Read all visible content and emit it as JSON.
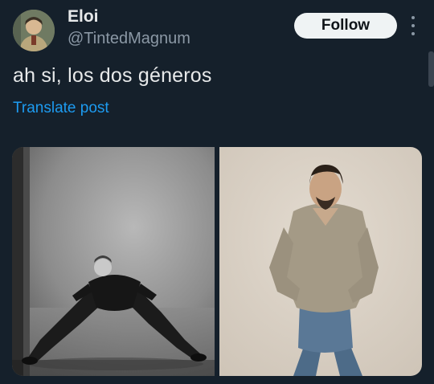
{
  "author": {
    "name": "Eloi",
    "handle": "@TintedMagnum"
  },
  "actions": {
    "follow_label": "Follow",
    "more_icon": "more-vertical-icon"
  },
  "post": {
    "text": "ah si, los dos géneros",
    "translate_label": "Translate post"
  },
  "colors": {
    "background": "#15202b",
    "text_primary": "#e7e9ea",
    "text_secondary": "#8b98a5",
    "link": "#1d9bf0",
    "follow_button_bg": "#eff3f4"
  }
}
